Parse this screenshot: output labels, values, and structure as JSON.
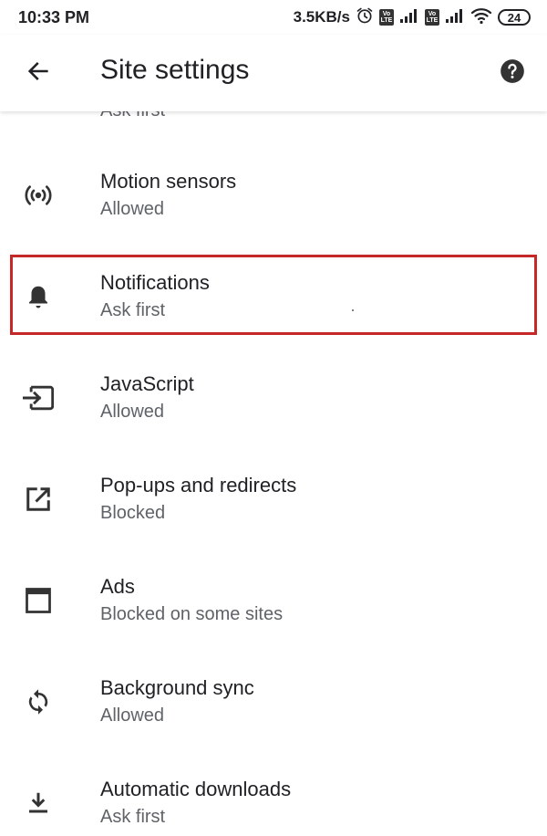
{
  "status_bar": {
    "time": "10:33 PM",
    "net_speed": "3.5KB/s",
    "volte_label": "Vo LTE",
    "battery": "24",
    "icons": [
      "alarm-icon",
      "volte-badge",
      "signal-icon",
      "volte-badge",
      "signal-icon",
      "wifi-icon",
      "battery-icon"
    ]
  },
  "toolbar": {
    "title": "Site settings",
    "back_icon": "arrow-back-icon",
    "help_icon": "help-circle-icon"
  },
  "list": {
    "clipped_previous_subtitle": "Ask first",
    "items": [
      {
        "title": "Motion sensors",
        "subtitle": "Allowed",
        "icon": "motion-sensor-icon"
      },
      {
        "title": "Notifications",
        "subtitle": "Ask first",
        "icon": "bell-icon",
        "highlighted": true
      },
      {
        "title": "JavaScript",
        "subtitle": "Allowed",
        "icon": "javascript-icon"
      },
      {
        "title": "Pop-ups and redirects",
        "subtitle": "Blocked",
        "icon": "open-in-new-icon"
      },
      {
        "title": "Ads",
        "subtitle": "Blocked on some sites",
        "icon": "ads-window-icon"
      },
      {
        "title": "Background sync",
        "subtitle": "Allowed",
        "icon": "sync-icon"
      },
      {
        "title": "Automatic downloads",
        "subtitle": "Ask first",
        "icon": "download-icon"
      }
    ]
  },
  "colors": {
    "highlight_border": "#c62828",
    "text_primary": "#202124",
    "text_secondary": "#5f6368",
    "icon": "#333333"
  }
}
